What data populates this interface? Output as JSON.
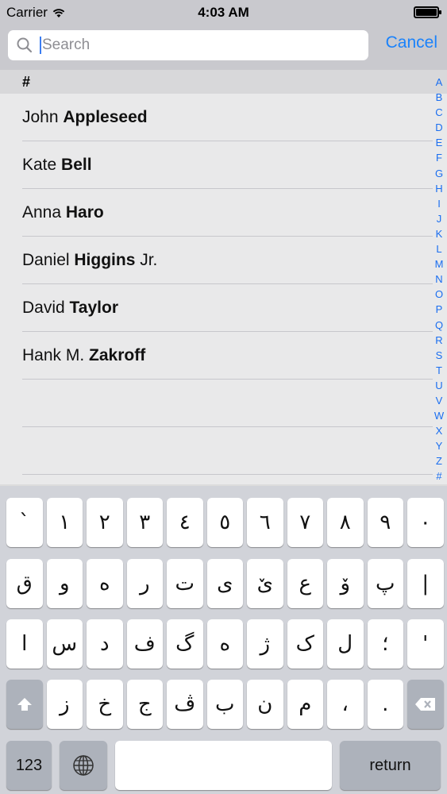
{
  "status_bar": {
    "carrier": "Carrier",
    "time": "4:03 AM"
  },
  "search": {
    "placeholder": "Search",
    "cancel_label": "Cancel"
  },
  "section_header": "#",
  "contacts": [
    {
      "first": "John",
      "last": "Appleseed",
      "suffix": ""
    },
    {
      "first": "Kate",
      "last": "Bell",
      "suffix": ""
    },
    {
      "first": "Anna",
      "last": "Haro",
      "suffix": ""
    },
    {
      "first": "Daniel",
      "last": "Higgins",
      "suffix": "Jr."
    },
    {
      "first": "David",
      "last": "Taylor",
      "suffix": ""
    },
    {
      "first": "Hank M.",
      "last": "Zakroff",
      "suffix": ""
    }
  ],
  "index_letters": [
    "A",
    "B",
    "C",
    "D",
    "E",
    "F",
    "G",
    "H",
    "I",
    "J",
    "K",
    "L",
    "M",
    "N",
    "O",
    "P",
    "Q",
    "R",
    "S",
    "T",
    "U",
    "V",
    "W",
    "X",
    "Y",
    "Z",
    "#"
  ],
  "keyboard": {
    "row1": [
      "`",
      "١",
      "٢",
      "٣",
      "٤",
      "٥",
      "٦",
      "٧",
      "٨",
      "٩",
      "٠"
    ],
    "row2": [
      "ق",
      "و",
      "ە",
      "ر",
      "ت",
      "ی",
      "ێ",
      "ع",
      "ۆ",
      "پ",
      "|"
    ],
    "row3": [
      "ا",
      "س",
      "د",
      "ف",
      "گ",
      "ه",
      "ژ",
      "ک",
      "ل",
      "؛",
      "'"
    ],
    "row4": [
      "ز",
      "خ",
      "ج",
      "ڤ",
      "ب",
      "ن",
      "م",
      "،",
      "."
    ],
    "num_label": "123",
    "return_label": "return"
  },
  "colors": {
    "accent": "#1a82fb",
    "index": "#1a6ef0"
  }
}
